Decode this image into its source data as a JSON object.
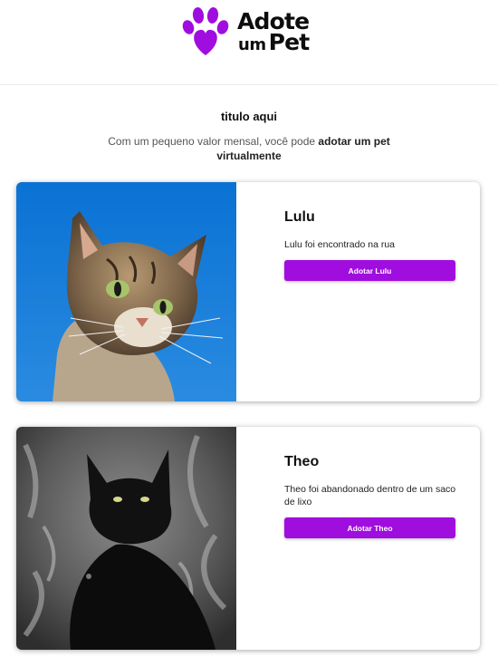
{
  "brand": {
    "line1": "Adote",
    "line2_small": "um",
    "line2_big": "Pet",
    "accent_color": "#a00ddf",
    "icon": "paw-heart-icon"
  },
  "hero": {
    "title": "titulo aqui",
    "subtitle_prefix": "Com um pequeno valor mensal, você pode ",
    "subtitle_bold": "adotar um pet virtualmente"
  },
  "pets": [
    {
      "name": "Lulu",
      "description": "Lulu foi encontrado na rua",
      "button_label": "Adotar Lulu",
      "photo": "tabby-cat-photo"
    },
    {
      "name": "Theo",
      "description": "Theo foi abandonado dentro de um saco de lixo",
      "button_label": "Adotar Theo",
      "photo": "black-cat-photo"
    }
  ]
}
